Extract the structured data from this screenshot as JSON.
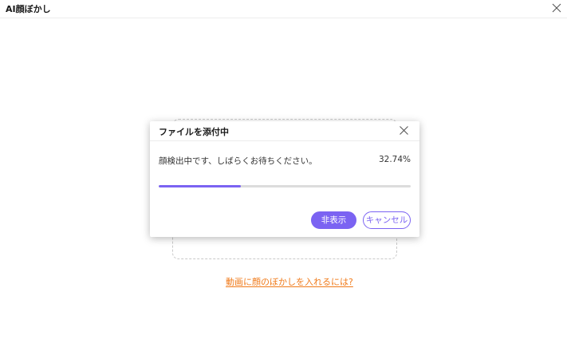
{
  "window": {
    "title": "AI顔ぼかし",
    "close_icon": "close-icon"
  },
  "main": {
    "help_link": "動画に顔のぼかしを入れるには?"
  },
  "dialog": {
    "title": "ファイルを添付中",
    "close_icon": "close-icon",
    "status_text": "顔検出中です、しばらくお待ちください。",
    "progress_label": "32.74%",
    "progress_fraction": 0.3274,
    "hide_button": "非表示",
    "cancel_button": "キャンセル"
  },
  "colors": {
    "accent": "#7b63f2",
    "link": "#f07a1a",
    "track": "#dcdcdc"
  }
}
